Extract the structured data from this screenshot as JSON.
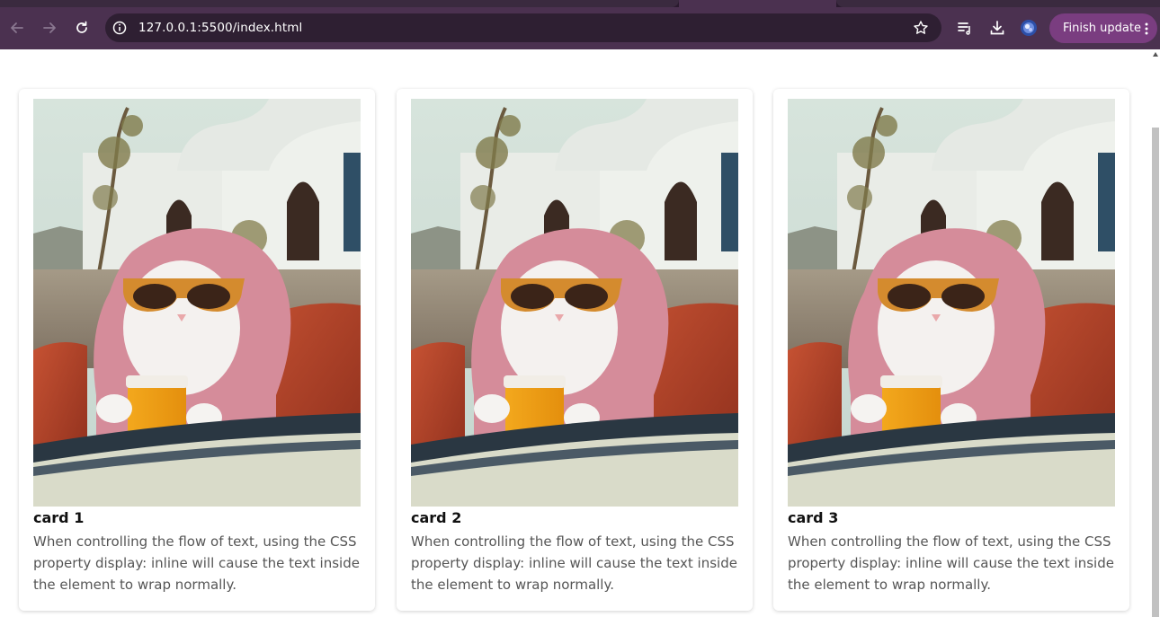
{
  "browser": {
    "url": "127.0.0.1:5500/index.html",
    "finish_update_label": "Finish update",
    "accent": "#7a3d80",
    "chrome_color": "#4b3150"
  },
  "cards": [
    {
      "title": "card 1",
      "description": "When controlling the flow of text, using the CSS property display: inline will cause the text inside the element to wrap normally."
    },
    {
      "title": "card 2",
      "description": "When controlling the flow of text, using the CSS property display: inline will cause the text inside the element to wrap normally."
    },
    {
      "title": "card 3",
      "description": "When controlling the flow of text, using the CSS property display: inline will cause the text inside the element to wrap normally."
    }
  ]
}
